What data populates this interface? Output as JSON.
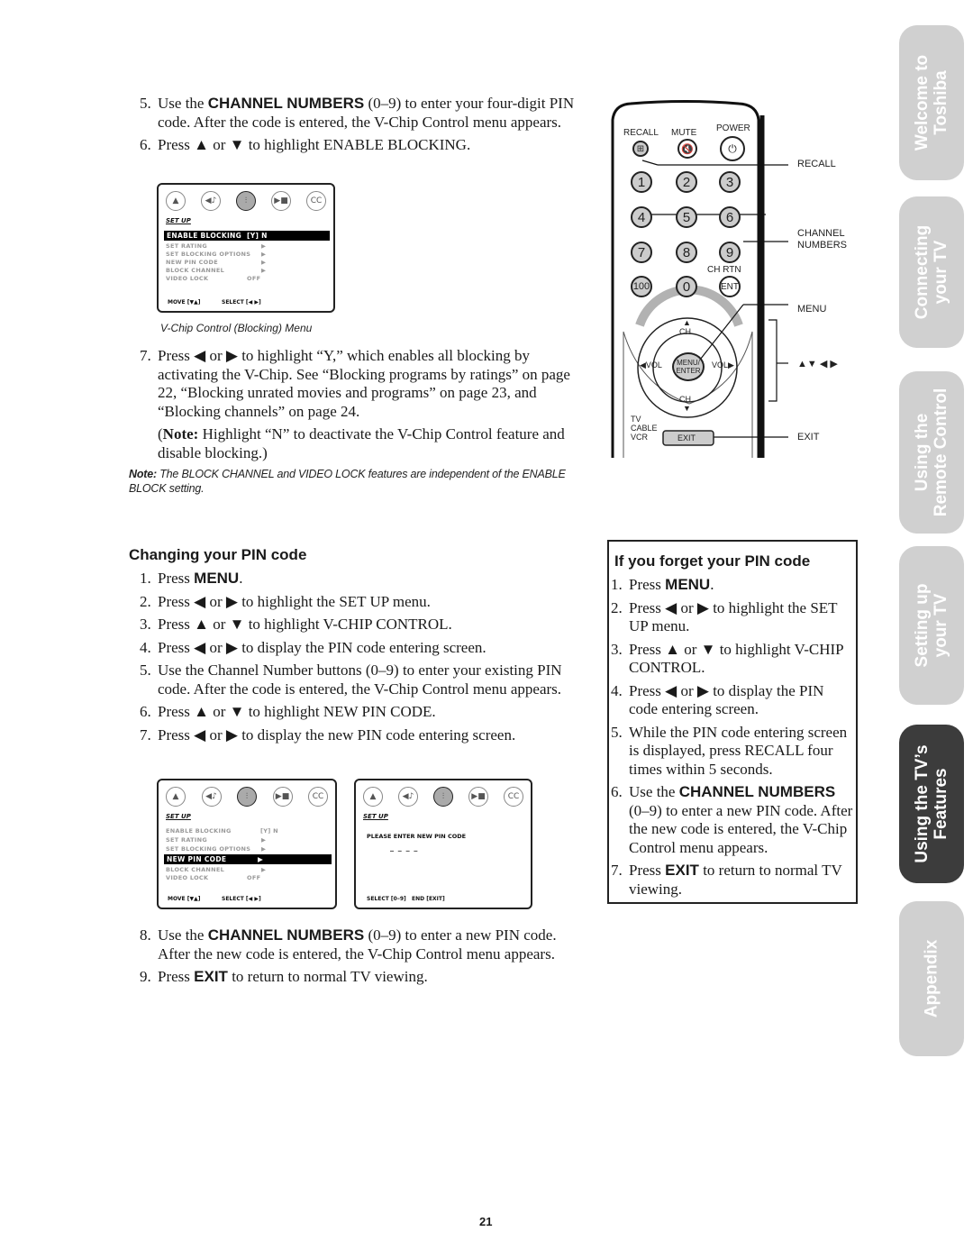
{
  "top_steps": [
    {
      "num": "5.",
      "pre": "Use the ",
      "bold": "CHANNEL NUMBERS",
      "post": " (0–9) to enter your four-digit PIN code. After the code is entered, the V-Chip Control menu appears."
    },
    {
      "num": "6.",
      "text": "Press ▲ or ▼ to highlight ENABLE BLOCKING."
    }
  ],
  "osd1": {
    "title": "SET UP",
    "rows": [
      {
        "label": "ENABLE BLOCKING",
        "value": "[Y] N",
        "highlighted": true
      },
      {
        "label": "SET RATING",
        "value": "▶"
      },
      {
        "label": "SET BLOCKING OPTIONS",
        "value": "▶"
      },
      {
        "label": "NEW PIN CODE",
        "value": "▶"
      },
      {
        "label": "BLOCK CHANNEL",
        "value": "▶"
      },
      {
        "label": "VIDEO LOCK",
        "value": "OFF"
      }
    ],
    "footer_move": "MOVE [▼▲]",
    "footer_select": "SELECT [◀ ▶]",
    "caption": "V-Chip Control (Blocking) Menu"
  },
  "step7": {
    "num": "7.",
    "text": "Press ◀ or ▶ to highlight “Y,” which enables all blocking by activating the V-Chip. See “Blocking programs by ratings” on page 22, “Blocking unrated movies and programs” on page 23, and “Blocking channels” on page 24."
  },
  "step7_note": {
    "label": "Note:",
    "text": " Highlight “N” to deactivate the V-Chip Control feature and disable blocking.)"
  },
  "side_note": {
    "label": "Note:",
    "text": " The BLOCK CHANNEL and VIDEO LOCK features are independent of the ENABLE BLOCK setting."
  },
  "changing": {
    "heading": "Changing your PIN code",
    "steps": [
      {
        "num": "1.",
        "pre": "Press ",
        "bold": "MENU",
        "post": "."
      },
      {
        "num": "2.",
        "text": "Press ◀ or ▶ to highlight the SET UP menu."
      },
      {
        "num": "3.",
        "text": "Press ▲ or ▼ to highlight V-CHIP CONTROL."
      },
      {
        "num": "4.",
        "text": "Press ◀ or ▶ to display the PIN code entering screen."
      },
      {
        "num": "5.",
        "text": "Use the Channel Number buttons (0–9) to enter your existing PIN code. After the code is entered, the V-Chip Control menu appears."
      },
      {
        "num": "6.",
        "text": "Press ▲ or ▼ to highlight NEW PIN CODE."
      },
      {
        "num": "7.",
        "text": "Press ◀ or ▶ to display the new PIN code entering screen."
      }
    ]
  },
  "osd2": {
    "title": "SET UP",
    "rows": [
      {
        "label": "ENABLE BLOCKING",
        "value": "[Y] N"
      },
      {
        "label": "SET RATING",
        "value": "▶"
      },
      {
        "label": "SET BLOCKING OPTIONS",
        "value": "▶"
      },
      {
        "label": "NEW PIN CODE",
        "value": "▶",
        "highlighted": true
      },
      {
        "label": "BLOCK CHANNEL",
        "value": "▶"
      },
      {
        "label": "VIDEO LOCK",
        "value": "OFF"
      }
    ],
    "footer_move": "MOVE [▼▲]",
    "footer_select": "SELECT [◀ ▶]"
  },
  "osd3": {
    "title": "SET UP",
    "prompt": "PLEASE ENTER NEW PIN CODE",
    "pin_placeholder": "_ _ _ _",
    "footer": "SELECT [0–9]   END [EXIT]"
  },
  "bottom_steps": [
    {
      "num": "8.",
      "pre": "Use the ",
      "bold": "CHANNEL NUMBERS",
      "post": " (0–9) to enter a new PIN code. After the new code is entered, the V-Chip Control menu appears."
    },
    {
      "num": "9.",
      "pre": "Press ",
      "bold": "EXIT",
      "post": " to return to normal TV viewing."
    }
  ],
  "forgot": {
    "heading": "If you forget your PIN code",
    "steps": [
      {
        "num": "1.",
        "pre": "Press ",
        "bold": "MENU",
        "post": "."
      },
      {
        "num": "2.",
        "text": "Press ◀ or ▶ to highlight the SET UP menu."
      },
      {
        "num": "3.",
        "text": "Press ▲ or ▼ to highlight V-CHIP CONTROL."
      },
      {
        "num": "4.",
        "text": "Press ◀ or ▶ to display the PIN code entering screen."
      },
      {
        "num": "5.",
        "text": "While the PIN code entering screen is displayed, press RECALL four times within 5 seconds."
      },
      {
        "num": "6.",
        "pre": "Use the ",
        "bold": "CHANNEL NUMBERS",
        "post": " (0–9) to enter a new PIN code. After the new code is entered, the V-Chip Control menu appears."
      },
      {
        "num": "7.",
        "pre": "Press ",
        "bold": "EXIT",
        "post": " to return to normal TV viewing."
      }
    ]
  },
  "remote": {
    "top_labels": {
      "recall": "RECALL",
      "mute": "MUTE",
      "power": "POWER"
    },
    "numbers": [
      "1",
      "2",
      "3",
      "4",
      "5",
      "6",
      "7",
      "8",
      "9",
      "100",
      "0",
      "ENT"
    ],
    "ch_rtn": "CH RTN",
    "ch": "CH",
    "vol": "VOL",
    "menu_enter": "MENU/ ENTER",
    "exit": "EXIT",
    "modes": [
      "TV",
      "CABLE",
      "VCR"
    ],
    "callouts": {
      "recall": "RECALL",
      "channel_numbers": "CHANNEL NUMBERS",
      "menu": "MENU",
      "arrows": "▲▼ ◀ ▶",
      "exit": "EXIT"
    }
  },
  "side_tabs": [
    {
      "line1": "Welcome to",
      "line2": "Toshiba",
      "active": false
    },
    {
      "line1": "Connecting",
      "line2": "your TV",
      "active": false
    },
    {
      "line1": "Using the",
      "line2": "Remote Control",
      "active": false
    },
    {
      "line1": "Setting up",
      "line2": "your TV",
      "active": false
    },
    {
      "line1": "Using the TV’s",
      "line2": "Features",
      "active": true
    },
    {
      "line1": "Appendix",
      "line2": "",
      "active": false
    }
  ],
  "page_number": "21"
}
